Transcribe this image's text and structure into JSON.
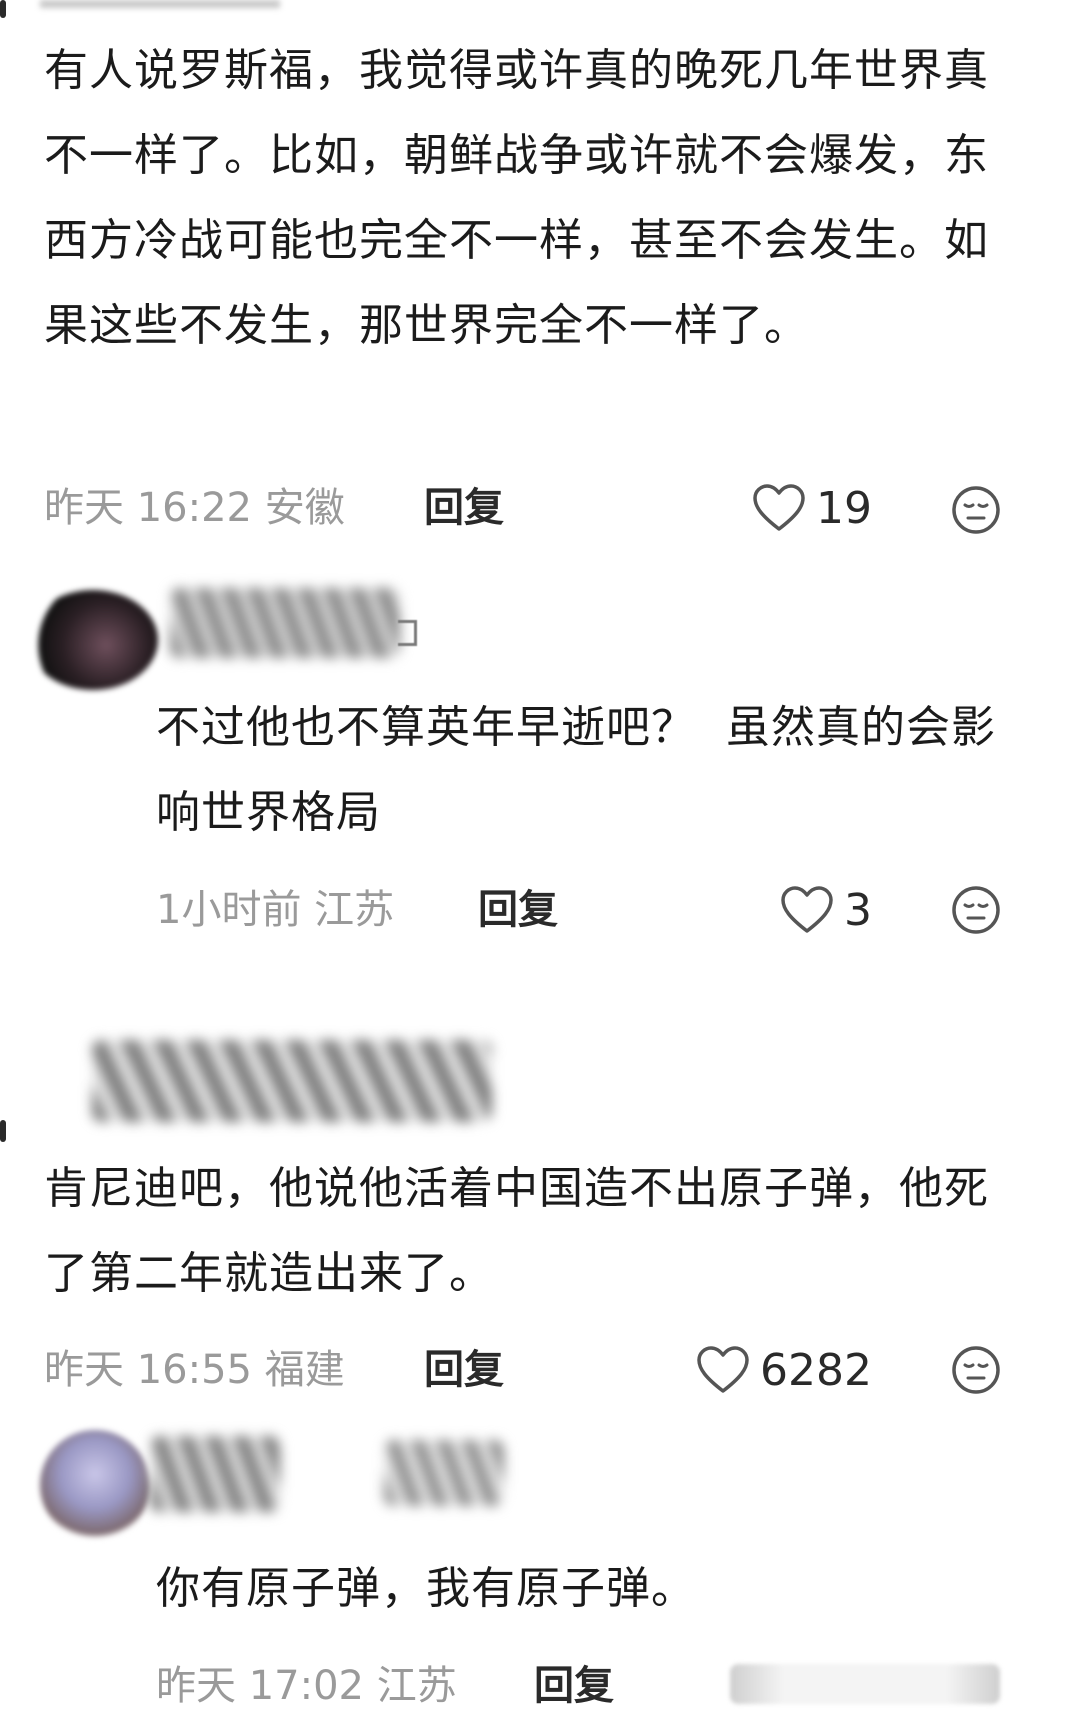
{
  "comments": [
    {
      "text": "有人说罗斯福，我觉得或许真的晚死几年世界真不一样了。比如，朝鲜战争或许就不会爆发，东西方冷战可能也完全不一样，甚至不会发生。如果这些不发生，那世界完全不一样了。",
      "time": "昨天 16:22 安徽",
      "reply": "回复",
      "likes": "19"
    },
    {
      "text": "不过他也不算英年早逝吧？  虽然真的会影响世界格局",
      "time": "1小时前 江苏",
      "reply": "回复",
      "likes": "3"
    },
    {
      "text": "肯尼迪吧，他说他活着中国造不出原子弹，他死了第二年就造出来了。",
      "time": "昨天 16:55 福建",
      "reply": "回复",
      "likes": "6282"
    },
    {
      "text": "你有原子弹，我有原子弹。",
      "time": "昨天 17:02 江苏",
      "reply": "回复"
    }
  ],
  "colors": {
    "text": "#1b1b1b",
    "meta": "#9a9a9a",
    "icon": "#555555"
  }
}
